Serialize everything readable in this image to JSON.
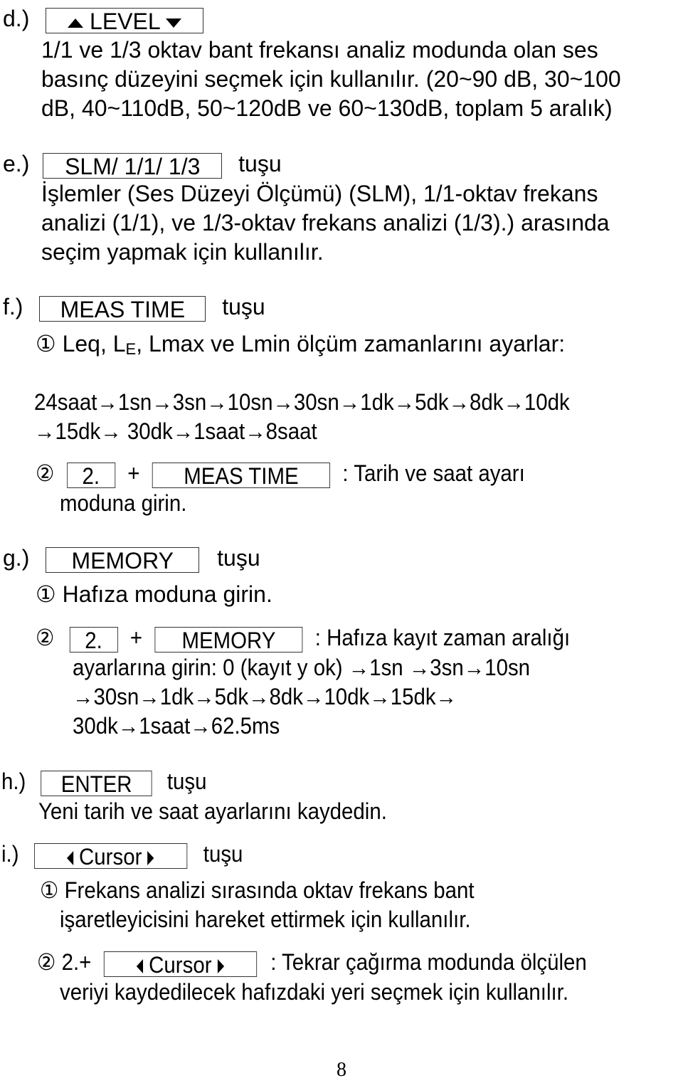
{
  "sections": {
    "d": {
      "label": "d.)",
      "key": "LEVEL",
      "lines": [
        "1/1 ve 1/3 oktav bant frekansı analiz modunda olan ses",
        "basınç düzeyini seçmek için kullanılır.   (20~90 dB, 30~100",
        "dB, 40~110dB, 50~120dB ve 60~130dB, toplam 5 aralık)"
      ]
    },
    "e": {
      "label": "e.)",
      "key": "SLM/ 1/1/ 1/3",
      "suffix": "tuşu",
      "lines": [
        "İşlemler (Ses Düzeyi Ölçümü) (SLM), 1/1-oktav frekans",
        "analizi (1/1), ve 1/3-oktav frekans analizi (1/3).) arasında",
        "seçim yapmak için kullanılır."
      ]
    },
    "f": {
      "label": "f.)",
      "key": "MEAS TIME",
      "suffix": "tuşu",
      "item1_marker": "①",
      "item1_pre": "Leq, L",
      "item1_sub": "E",
      "item1_post": ", Lmax ve Lmin ölçüm zamanlarını ayarlar:",
      "sequence": [
        "24saat→1sn→3sn→10sn→30sn→1dk→5dk→8dk→10dk",
        "→15dk→ 30dk→1saat→8saat"
      ],
      "item2_marker": "②",
      "item2_key1": "2.",
      "item2_plus": "+",
      "item2_key2": "MEAS TIME",
      "item2_text": ": Tarih ve saat ayarı",
      "item2_cont": "moduna girin."
    },
    "g": {
      "label": "g.)",
      "key": "MEMORY",
      "suffix": "tuşu",
      "item1_marker": "①",
      "item1_text": "Hafıza moduna girin.",
      "item2_marker": "②",
      "item2_key1": "2.",
      "item2_plus": "+",
      "item2_key2": "MEMORY",
      "item2_text": ": Hafıza kayıt zaman aralığı",
      "item2_lines": [
        "ayarlarına girin: 0 (kayıt y ok) →1sn →3sn→10sn",
        "→30sn→1dk→5dk→8dk→10dk→15dk→",
        "30dk→1saat→62.5ms"
      ]
    },
    "h": {
      "label": "h.)",
      "key": "ENTER",
      "suffix": "tuşu",
      "text": "Yeni tarih ve saat ayarlarını kaydedin."
    },
    "i": {
      "label": "i.)",
      "key": "Cursor",
      "suffix": "tuşu",
      "item1_marker": "①",
      "item1_lines": [
        "Frekans analizi sırasında oktav frekans bant",
        "işaretleyicisini hareket ettirmek için kullanılır."
      ],
      "item2_marker": "②",
      "item2_prefix": "2.+",
      "item2_key": "Cursor",
      "item2_text": ": Tekrar çağırma modunda ölçülen",
      "item2_cont": "veriyi kaydedilecek hafızdaki yeri seçmek için kullanılır."
    }
  },
  "page_number": "8"
}
